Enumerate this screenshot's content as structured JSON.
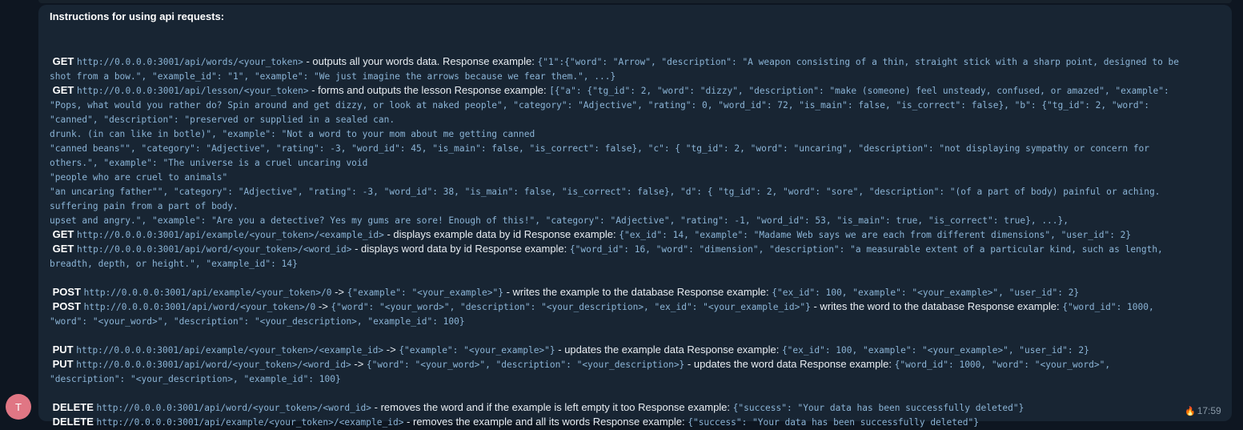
{
  "message": {
    "title": "Instructions for using api requests:",
    "sender_initial": "T",
    "reaction": "🔥",
    "time": "17:59",
    "lines": [
      {
        "type": "gap"
      },
      {
        "segs": [
          {
            "t": "m",
            "v": " GET "
          },
          {
            "t": "c",
            "v": "http://0.0.0.0:3001/api/words/<your_token>"
          },
          {
            "t": "n",
            "v": " - outputs all your words data. Response example: "
          },
          {
            "t": "c",
            "v": "{\"1\":{\"word\": \"Arrow\", \"description\": \"A weapon consisting of a thin, straight stick with a sharp point, designed to be"
          }
        ]
      },
      {
        "segs": [
          {
            "t": "c",
            "v": "shot from a bow.\", \"example_id\": \"1\", \"example\": \"We just imagine the arrows because we fear them.\", ...}"
          }
        ]
      },
      {
        "segs": [
          {
            "t": "m",
            "v": " GET "
          },
          {
            "t": "c",
            "v": "http://0.0.0.0:3001/api/lesson/<your_token>"
          },
          {
            "t": "n",
            "v": " - forms and outputs the lesson Response example: "
          },
          {
            "t": "c",
            "v": "[{\"a\": {\"tg_id\": 2, \"word\": \"dizzy\", \"description\": \"make (someone) feel unsteady, confused, or amazed\", \"example\":"
          }
        ]
      },
      {
        "segs": [
          {
            "t": "c",
            "v": "\"Pops, what would you rather do? Spin around and get dizzy, or look at naked people\", \"category\": \"Adjective\", \"rating\": 0, \"word_id\": 72, \"is_main\": false, \"is_correct\": false}, \"b\": {\"tg_id\": 2, \"word\":"
          }
        ]
      },
      {
        "segs": [
          {
            "t": "c",
            "v": "\"canned\", \"description\": \"preserved or supplied in a sealed can."
          }
        ]
      },
      {
        "segs": [
          {
            "t": "c",
            "v": "drunk. (in can like in botle)\", \"example\": \"Not a word to your mom about me getting canned"
          }
        ]
      },
      {
        "segs": [
          {
            "t": "c",
            "v": "\"canned beans\"\", \"category\": \"Adjective\", \"rating\": -3, \"word_id\": 45, \"is_main\": false, \"is_correct\": false}, \"c\": { \"tg_id\": 2, \"word\": \"uncaring\", \"description\": \"not displaying sympathy or concern for"
          }
        ]
      },
      {
        "segs": [
          {
            "t": "c",
            "v": "others.\", \"example\": \"The universe is a cruel uncaring void"
          }
        ]
      },
      {
        "segs": [
          {
            "t": "c",
            "v": "\"people who are cruel to animals\""
          }
        ]
      },
      {
        "segs": [
          {
            "t": "c",
            "v": "\"an uncaring father\"\", \"category\": \"Adjective\", \"rating\": -3, \"word_id\": 38, \"is_main\": false, \"is_correct\": false}, \"d\": { \"tg_id\": 2, \"word\": \"sore\", \"description\": \"(of a part of body) painful or aching."
          }
        ]
      },
      {
        "segs": [
          {
            "t": "c",
            "v": "suffering pain from a part of body."
          }
        ]
      },
      {
        "segs": [
          {
            "t": "c",
            "v": "upset and angry.\", \"example\": \"Are you a detective? Yes my gums are sore! Enough of this!\", \"category\": \"Adjective\", \"rating\": -1, \"word_id\": 53, \"is_main\": true, \"is_correct\": true}, ...},"
          }
        ]
      },
      {
        "segs": [
          {
            "t": "m",
            "v": " GET "
          },
          {
            "t": "c",
            "v": "http://0.0.0.0:3001/api/example/<your_token>/<example_id>"
          },
          {
            "t": "n",
            "v": " - displays example data by id Response example: "
          },
          {
            "t": "c",
            "v": "{\"ex_id\": 14, \"example\": \"Madame Web says we are each from different dimensions\", \"user_id\": 2}"
          }
        ]
      },
      {
        "segs": [
          {
            "t": "m",
            "v": " GET "
          },
          {
            "t": "c",
            "v": "http://0.0.0.0:3001/api/word/<your_token>/<word_id>"
          },
          {
            "t": "n",
            "v": " - displays word data by id Response example: "
          },
          {
            "t": "c",
            "v": "{\"word_id\": 16, \"word\": \"dimension\", \"description\": \"a measurable extent of a particular kind, such as length,"
          }
        ]
      },
      {
        "segs": [
          {
            "t": "c",
            "v": "breadth, depth, or height.\", \"example_id\": 14}"
          }
        ]
      },
      {
        "type": "gap"
      },
      {
        "segs": [
          {
            "t": "m",
            "v": " POST "
          },
          {
            "t": "c",
            "v": "http://0.0.0.0:3001/api/example/<your_token>/0"
          },
          {
            "t": "n",
            "v": " -> "
          },
          {
            "t": "c",
            "v": "{\"example\": \"<your_example>\"}"
          },
          {
            "t": "n",
            "v": " - writes the example to the database Response example: "
          },
          {
            "t": "c",
            "v": "{\"ex_id\": 100, \"example\": \"<your_example>\", \"user_id\": 2}"
          }
        ]
      },
      {
        "segs": [
          {
            "t": "m",
            "v": " POST "
          },
          {
            "t": "c",
            "v": "http://0.0.0.0:3001/api/word/<your_token>/0"
          },
          {
            "t": "n",
            "v": " -> "
          },
          {
            "t": "c",
            "v": "{\"word\": \"<your_word>\", \"description\": \"<your_description>, \"ex_id\": \"<your_example_id>\"}"
          },
          {
            "t": "n",
            "v": " - writes the word to the database Response example: "
          },
          {
            "t": "c",
            "v": "{\"word_id\": 1000,"
          }
        ]
      },
      {
        "segs": [
          {
            "t": "c",
            "v": "\"word\": \"<your_word>\", \"description\": \"<your_description>, \"example_id\": 100}"
          }
        ]
      },
      {
        "type": "gap"
      },
      {
        "segs": [
          {
            "t": "m",
            "v": " PUT "
          },
          {
            "t": "c",
            "v": "http://0.0.0.0:3001/api/example/<your_token>/<example_id>"
          },
          {
            "t": "n",
            "v": " -> "
          },
          {
            "t": "c",
            "v": "{\"example\": \"<your_example>\"}"
          },
          {
            "t": "n",
            "v": " - updates the example data Response example: "
          },
          {
            "t": "c",
            "v": "{\"ex_id\": 100, \"example\": \"<your_example>\", \"user_id\": 2}"
          }
        ]
      },
      {
        "segs": [
          {
            "t": "m",
            "v": " PUT "
          },
          {
            "t": "c",
            "v": "http://0.0.0.0:3001/api/word/<your_token>/<word_id>"
          },
          {
            "t": "n",
            "v": " -> "
          },
          {
            "t": "c",
            "v": "{\"word\": \"<your_word>\", \"description\": \"<your_description>}"
          },
          {
            "t": "n",
            "v": " - updates the word data Response example: "
          },
          {
            "t": "c",
            "v": "{\"word_id\": 1000, \"word\": \"<your_word>\","
          }
        ]
      },
      {
        "segs": [
          {
            "t": "c",
            "v": "\"description\": \"<your_description>, \"example_id\": 100}"
          }
        ]
      },
      {
        "type": "gap"
      },
      {
        "segs": [
          {
            "t": "m",
            "v": " DELETE "
          },
          {
            "t": "c",
            "v": "http://0.0.0.0:3001/api/word/<your_token>/<word_id>"
          },
          {
            "t": "n",
            "v": " - removes the word and if the example is left empty it too Response example: "
          },
          {
            "t": "c",
            "v": "{\"success\": \"Your data has been successfully deleted\"}"
          }
        ]
      },
      {
        "segs": [
          {
            "t": "m",
            "v": " DELETE "
          },
          {
            "t": "c",
            "v": "http://0.0.0.0:3001/api/example/<your_token>/<example_id>"
          },
          {
            "t": "n",
            "v": " - removes the example and all its words Response example: "
          },
          {
            "t": "c",
            "v": "{\"success\": \"Your data has been successfully deleted\"}"
          }
        ]
      }
    ]
  }
}
